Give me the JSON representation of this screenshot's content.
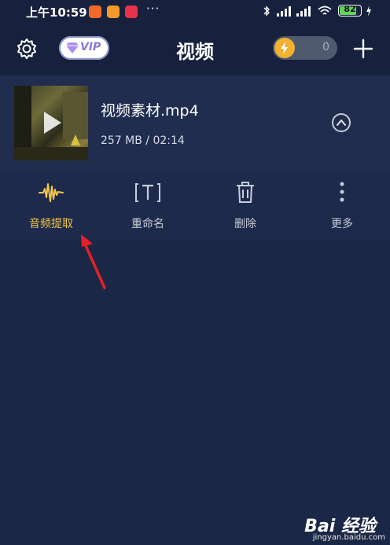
{
  "status_bar": {
    "time": "上午10:59",
    "more_dots": "···",
    "battery_level": 82,
    "battery_text": "82",
    "app_icons": [
      "notification-app-icon-orange",
      "notification-app-icon-yellow",
      "notification-app-icon-red"
    ]
  },
  "header": {
    "title": "视频",
    "vip_label": "VIP",
    "coin_count": "0"
  },
  "video": {
    "file_name": "视频素材.mp4",
    "meta": "257 MB / 02:14"
  },
  "actions": [
    {
      "label": "音频提取",
      "icon": "audio-wave-icon",
      "active": true
    },
    {
      "label": "重命名",
      "icon": "rename-icon",
      "active": false
    },
    {
      "label": "删除",
      "icon": "trash-icon",
      "active": false
    },
    {
      "label": "更多",
      "icon": "more-vertical-icon",
      "active": false
    }
  ],
  "watermark": {
    "text": "Bai 经验",
    "sub": "jingyan.baidu.com"
  },
  "colors": {
    "background": "#1b2746",
    "accent_active": "#f3c64a",
    "annotation_arrow": "#e5202a",
    "coin": "#f3b130"
  }
}
